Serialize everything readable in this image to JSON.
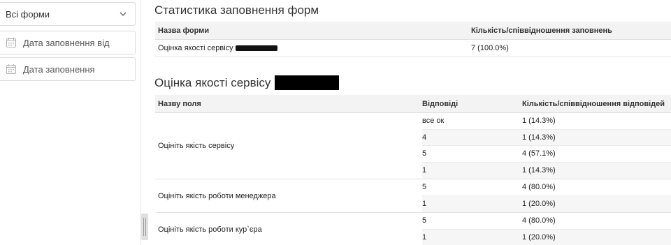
{
  "filters": {
    "form_select": "Всі форми",
    "date_from_placeholder": "Дата заповнення від",
    "date_to_placeholder": "Дата заповнення"
  },
  "stats": {
    "title": "Статистика заповнення форм",
    "columns": [
      "Назва форми",
      "Кількість/співвідношення заповнень"
    ],
    "rows": [
      {
        "name": "Оцінка якості сервісу",
        "count": "7 (100.0%)"
      }
    ]
  },
  "form_detail": {
    "title": "Оцінка якості сервісу",
    "columns": [
      "Назву поля",
      "Відповіді",
      "Кількість/співвідношення відповідей"
    ],
    "groups": [
      {
        "field": "Оцініть якість сервісу",
        "answers": [
          {
            "answer": "все ок",
            "count": "1 (14.3%)"
          },
          {
            "answer": "4",
            "count": "1 (14.3%)"
          },
          {
            "answer": "5",
            "count": "4 (57.1%)"
          },
          {
            "answer": "1",
            "count": "1 (14.3%)"
          }
        ]
      },
      {
        "field": "Оцініть якість роботи менеджера",
        "answers": [
          {
            "answer": "5",
            "count": "4 (80.0%)"
          },
          {
            "answer": "1",
            "count": "1 (20.0%)"
          }
        ]
      },
      {
        "field": "Оцініть якість роботи кур`єра",
        "answers": [
          {
            "answer": "5",
            "count": "4 (80.0%)"
          },
          {
            "answer": "1",
            "count": "1 (20.0%)"
          }
        ]
      }
    ]
  }
}
